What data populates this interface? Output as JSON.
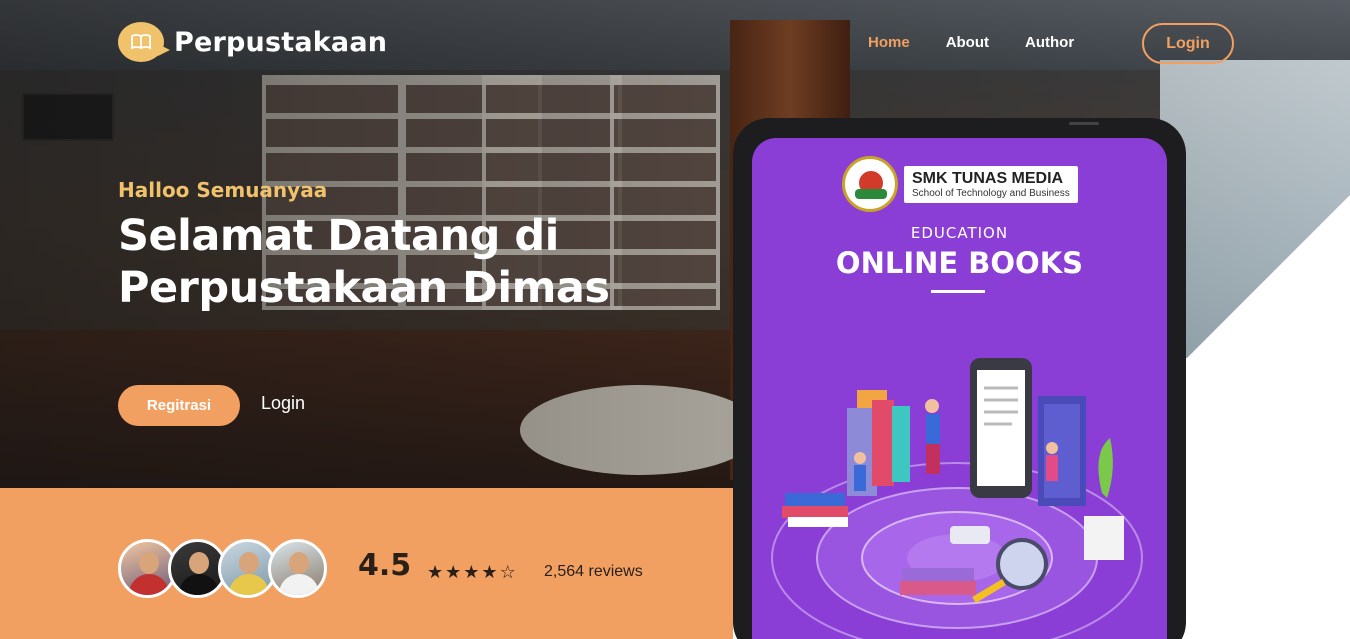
{
  "brand": {
    "name": "Perpustakaan",
    "logo_icon": "book-icon"
  },
  "nav": {
    "items": [
      {
        "label": "Home",
        "active": true
      },
      {
        "label": "About",
        "active": false
      },
      {
        "label": "Author",
        "active": false
      }
    ],
    "login_label": "Login"
  },
  "hero": {
    "greeting": "Halloo Semuanyaa",
    "headline": "Selamat Datang di Perpustakaan Dimas",
    "register_label": "Regitrasi",
    "login_label": "Login"
  },
  "reviews": {
    "rating": "4.5",
    "stars_filled": 4,
    "stars_total": 5,
    "count_label": "2,564 reviews"
  },
  "tablet": {
    "school_name": "SMK TUNAS MEDIA",
    "school_sub": "School of Technology and Business",
    "category": "EDUCATION",
    "title": "ONLINE BOOKS"
  },
  "colors": {
    "accent": "#f2a062",
    "greeting": "#f0c26b",
    "tablet_screen": "#8a3ed6"
  }
}
